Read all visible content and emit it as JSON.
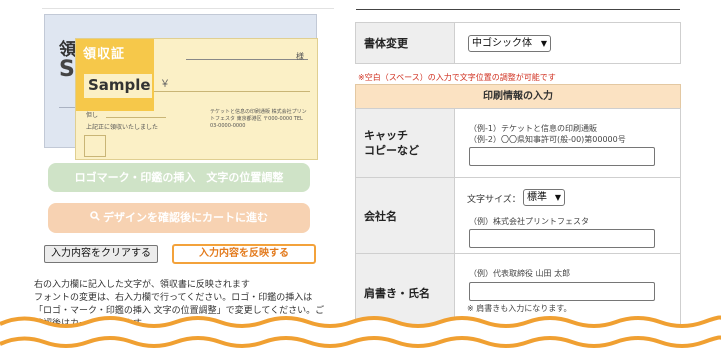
{
  "preview": {
    "back_title": "領収証",
    "back_sample": "Sa",
    "front_title": "領収証",
    "front_sample": "Sample",
    "front_yen": "￥",
    "front_sama": "様",
    "front_tadashi": "但し",
    "front_ue": "上記正に領収いたしました",
    "front_company": "テケットと信息の印刷通販 株式会社プリントフェスタ 東京都港区 〒000-0000 TEL 03-0000-0000"
  },
  "buttons": {
    "logo_insert": "ロゴマーク・印鑑の挿入　文字の位置調整",
    "proceed_cart": "デザインを確認後にカートに進む",
    "clear_input": "入力内容をクリアする",
    "reflect_input": "入力内容を反映する"
  },
  "note": {
    "lines": [
      "右の入力欄に記入した文字が、領収書に反映されます",
      "フォントの変更は、右入力欄で行ってください。ロゴ・印鑑の挿入は",
      "「ロゴ・マーク・印鑑の挿入 文字の位置調整」で変更してください。ご",
      "確認後はカートに進めます。"
    ]
  },
  "form": {
    "font_label": "書体変更",
    "font_value": "中ゴシック体",
    "space_warning": "※空白（スペース）の入力で文字位置の調整が可能です",
    "section_title": "印刷情報の入力",
    "catch_label_1": "キャッチ",
    "catch_label_2": "コピーなど",
    "catch_hint_1": "（例-1）テケットと信息の印刷通販",
    "catch_hint_2": "（例-2）〇〇県知事許可(般-00)第00000号",
    "company_label": "会社名",
    "char_size_label": "文字サイズ：",
    "char_size_value": "標準",
    "company_hint": "（例）株式会社プリントフェスタ",
    "title_label": "肩書き・氏名",
    "title_hint": "（例）代表取締役 山田 太郎",
    "title_note": "※ 肩書きも入力になります。"
  },
  "colors": {
    "accent_orange": "#f3a23b",
    "logo_button": "#cfe3c7",
    "cart_button": "#f7d2b2",
    "section_head": "#fbe2c2",
    "warning_red": "#d03020",
    "wave": "#f0a032"
  },
  "icons": {
    "cart_button_icon": "search-icon",
    "select_chevron": "chevron-down-icon"
  }
}
